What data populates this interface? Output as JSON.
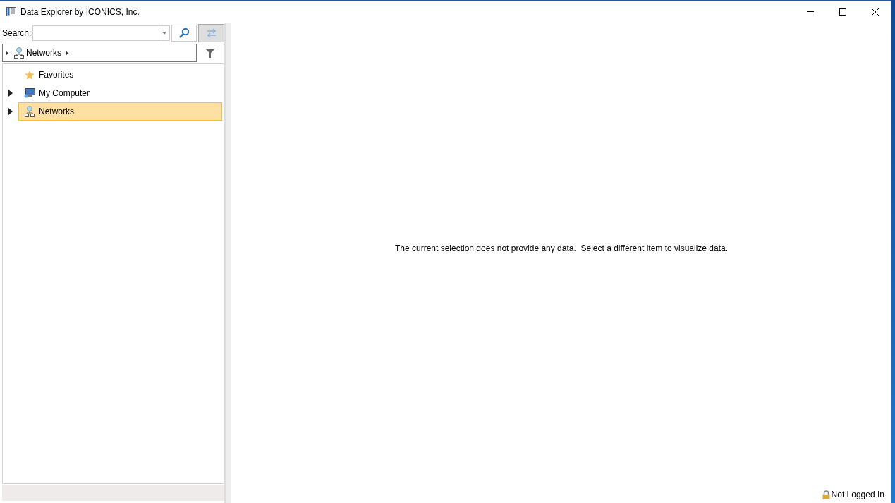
{
  "window": {
    "title": "Data Explorer by ICONICS, Inc."
  },
  "search": {
    "label": "Search:"
  },
  "breadcrumb": {
    "items": [
      {
        "label": "Networks",
        "kind": "network"
      }
    ]
  },
  "tree": {
    "items": [
      {
        "label": "Favorites",
        "kind": "star",
        "selected": false
      },
      {
        "label": "My Computer",
        "kind": "computer",
        "expanded": false,
        "selected": false
      },
      {
        "label": "Networks",
        "kind": "network",
        "expanded": false,
        "selected": true
      }
    ]
  },
  "main": {
    "message": "The current selection does not provide any data.  Select a different item to visualize data."
  },
  "status_bar": {
    "login": "Not Logged In"
  }
}
